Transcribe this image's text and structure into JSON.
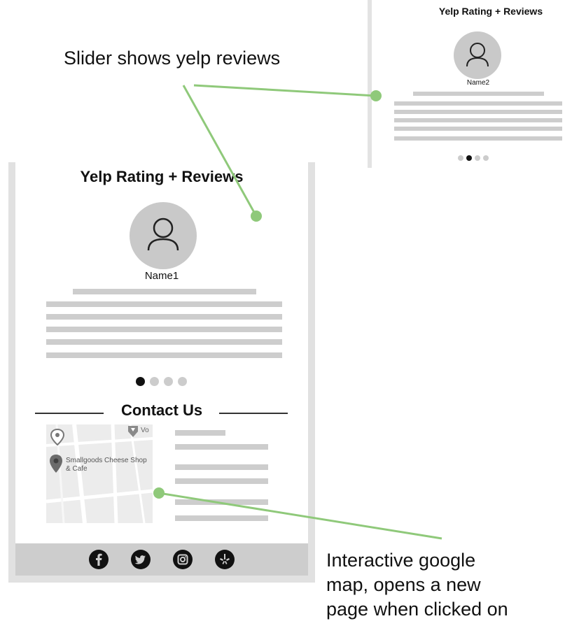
{
  "annotations": {
    "slider": "Slider shows yelp reviews",
    "map_line1": "Interactive google",
    "map_line2": "map, opens a new",
    "map_line3": "page when clicked on"
  },
  "preview": {
    "title": "Yelp Rating + Reviews",
    "reviewer_name": "Name2",
    "active_dot_index": 1,
    "dot_count": 4
  },
  "reviews_section": {
    "title": "Yelp Rating + Reviews",
    "reviewer_name": "Name1",
    "active_dot_index": 0,
    "dot_count": 4
  },
  "contact": {
    "title": "Contact Us",
    "map": {
      "place_label": "Smallgoods Cheese Shop & Cafe",
      "partial_label": "Vo"
    }
  },
  "footer": {
    "icons": [
      "facebook-icon",
      "twitter-icon",
      "instagram-icon",
      "yelp-icon"
    ]
  },
  "colors": {
    "connector": "#8fc97a",
    "placeholder": "#cdcdcd",
    "avatar": "#c9c9c9",
    "frame": "#e1e1e1"
  }
}
